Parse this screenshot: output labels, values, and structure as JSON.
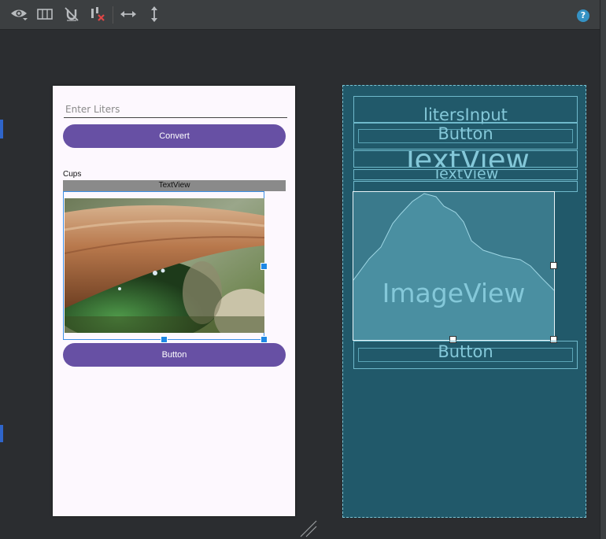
{
  "toolbar": {
    "icons": [
      "eye-icon",
      "blueprint-toggle-icon",
      "magnet-off-icon",
      "clear-constraints-icon",
      "horizontal-resize-icon",
      "vertical-resize-icon"
    ],
    "help_label": "?"
  },
  "phone": {
    "input_placeholder": "Enter Liters",
    "convert_label": "Convert",
    "cups_label": "Cups",
    "textview_label": "TextView",
    "bottom_button_label": "Button"
  },
  "blueprint": {
    "liters_input": "litersInput",
    "button_top": "Button",
    "textview_large": "TextView",
    "textview_small": "TextView",
    "imageview": "ImageView",
    "button_bottom": "Button"
  },
  "colors": {
    "primary_button": "#6750a4",
    "selection": "#1e88e5",
    "blueprint_bg": "#21596a"
  }
}
